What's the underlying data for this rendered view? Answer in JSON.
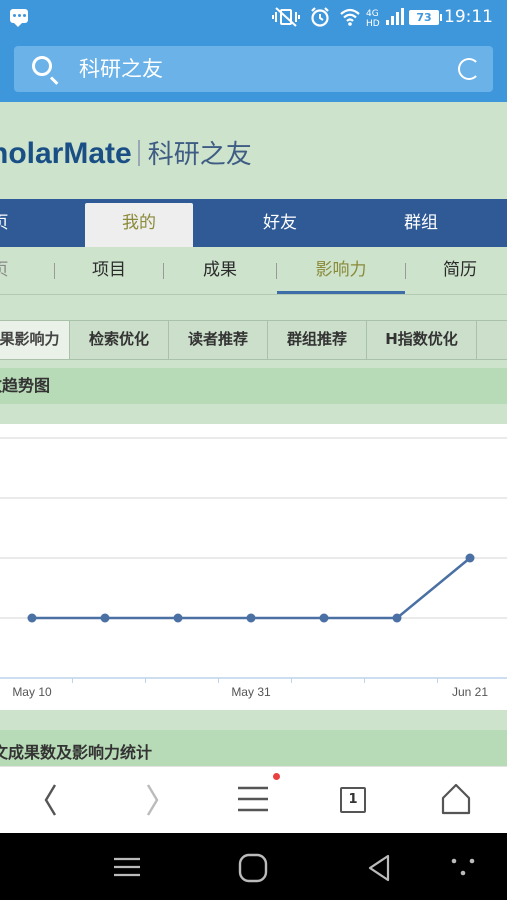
{
  "status_bar": {
    "battery": "73",
    "time": "19:11",
    "icons": [
      "chat-icon",
      "mute-vibrate-icon",
      "alarm-icon",
      "wifi-icon",
      "signal-icon",
      "battery-icon"
    ]
  },
  "browser": {
    "search_text": "科研之友",
    "icons": [
      "search-icon",
      "reload-icon"
    ]
  },
  "page": {
    "brand_en_red_prefix": "",
    "brand_en": "nolarMate",
    "brand_cn": "科研之友",
    "nav_tabs": [
      {
        "label": "页"
      },
      {
        "label": "我的"
      },
      {
        "label": "好友"
      },
      {
        "label": "群组"
      }
    ],
    "sub_tabs": [
      {
        "label": "页"
      },
      {
        "label": "项目"
      },
      {
        "label": "成果"
      },
      {
        "label": "影响力"
      },
      {
        "label": "简历"
      }
    ],
    "section_tabs": [
      {
        "label": "果影响力"
      },
      {
        "label": "检索优化"
      },
      {
        "label": "读者推荐"
      },
      {
        "label": "群组推荐"
      },
      {
        "label": "H指数优化"
      }
    ],
    "chart_section_title": "数趋势图",
    "bottom_section_title": "文成果数及影响力统计"
  },
  "chart_data": {
    "type": "line",
    "title": "",
    "xlabel": "",
    "ylabel": "",
    "x_tick_labels": [
      "May 10",
      "May 31",
      "Jun 21"
    ],
    "series": [
      {
        "values": [
          0,
          0,
          0,
          0,
          0,
          0,
          1
        ]
      }
    ],
    "ylim": [
      -1,
      3
    ],
    "grid": true,
    "color": "#4a70a4"
  },
  "toolbar": {
    "tab_count": "1",
    "icons": [
      "back-icon",
      "forward-icon",
      "menu-icon",
      "tabs-icon",
      "home-icon"
    ]
  },
  "system_nav": {
    "icons": [
      "menu-lines-icon",
      "home-circle-icon",
      "back-triangle-icon",
      "more-dots-icon"
    ]
  }
}
